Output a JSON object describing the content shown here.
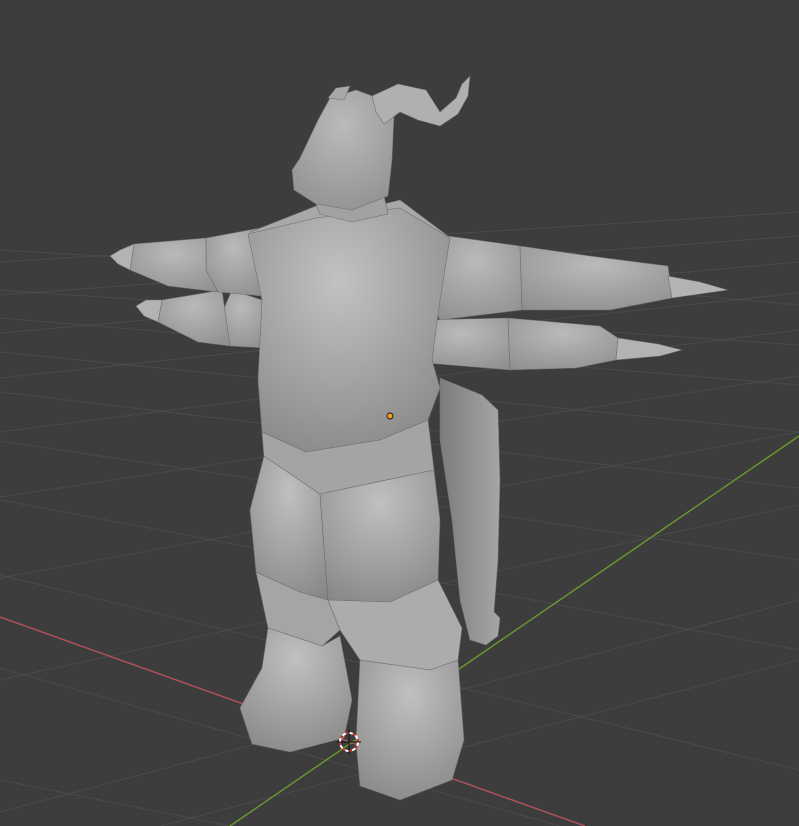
{
  "viewport": {
    "background_color": "#3d3d3d",
    "grid_color": "#4b4b4b",
    "x_axis_color": "#b5525c",
    "y_axis_color": "#6b9a2d",
    "mesh_color": "#9a9a9a",
    "origin_color": "#f0a020",
    "cursor_color": "#d03030"
  }
}
